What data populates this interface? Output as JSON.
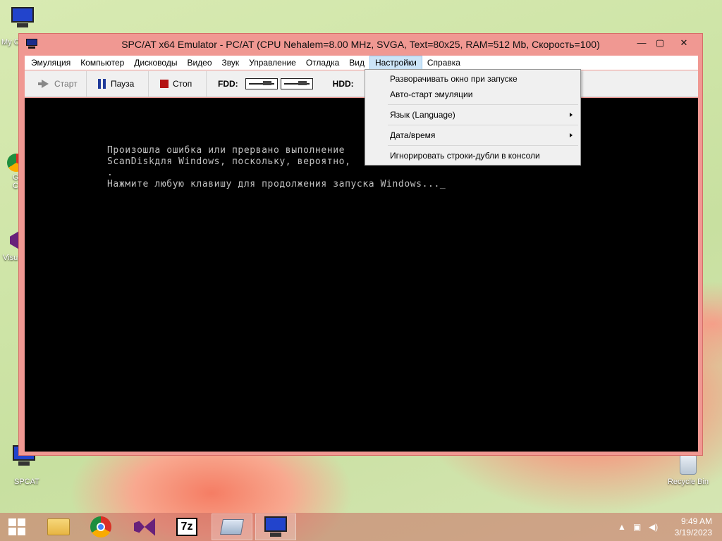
{
  "desktop": {
    "icons": [
      {
        "label": "My C"
      },
      {
        "label": "G\nC"
      },
      {
        "label": "Visu"
      },
      {
        "label": "SPCAT"
      },
      {
        "label": "Recycle Bin"
      }
    ]
  },
  "window": {
    "title": "SPC/AT x64 Emulator - PC/AT (CPU Nehalem=8.00 MHz, SVGA, Text=80x25, RAM=512 Mb, Скорость=100)",
    "controls": {
      "minimize": "—",
      "maximize": "▢",
      "close": "✕"
    }
  },
  "menubar": {
    "items": [
      "Эмуляция",
      "Компьютер",
      "Дисководы",
      "Видео",
      "Звук",
      "Управление",
      "Отладка",
      "Вид",
      "Настройки",
      "Справка"
    ],
    "active": "Настройки"
  },
  "toolbar": {
    "start": "Старт",
    "pause": "Пауза",
    "stop": "Стоп",
    "fdd_label": "FDD:",
    "hdd_label": "HDD:"
  },
  "console": {
    "lines": [
      "Произошла ошибка или прервано выполнение",
      "ScanDiskдля Windows, поскольку, вероятно,                          анены",
      ".",
      "Нажмите любую клавишу для продолжения запуска Windows..._"
    ]
  },
  "dropdown": {
    "items": [
      {
        "label": "Разворачивать окно при запуске",
        "submenu": false
      },
      {
        "label": "Авто-старт эмуляции",
        "submenu": false
      },
      {
        "label": "Язык (Language)",
        "submenu": true
      },
      {
        "label": "Дата/время",
        "submenu": true
      },
      {
        "label": "Игнорировать строки-дубли в консоли",
        "submenu": false
      }
    ]
  },
  "taskbar": {
    "apps": [
      "start-button",
      "file-explorer",
      "chrome",
      "visual-studio",
      "7zip",
      "keyboard-app",
      "spcat"
    ],
    "clock_time": "9:49 AM",
    "clock_date": "3/19/2023"
  },
  "colors": {
    "window_border": "#f09892",
    "menu_highlight": "#cce4f7",
    "console_bg": "#000000",
    "console_text": "#c0c0c0"
  }
}
